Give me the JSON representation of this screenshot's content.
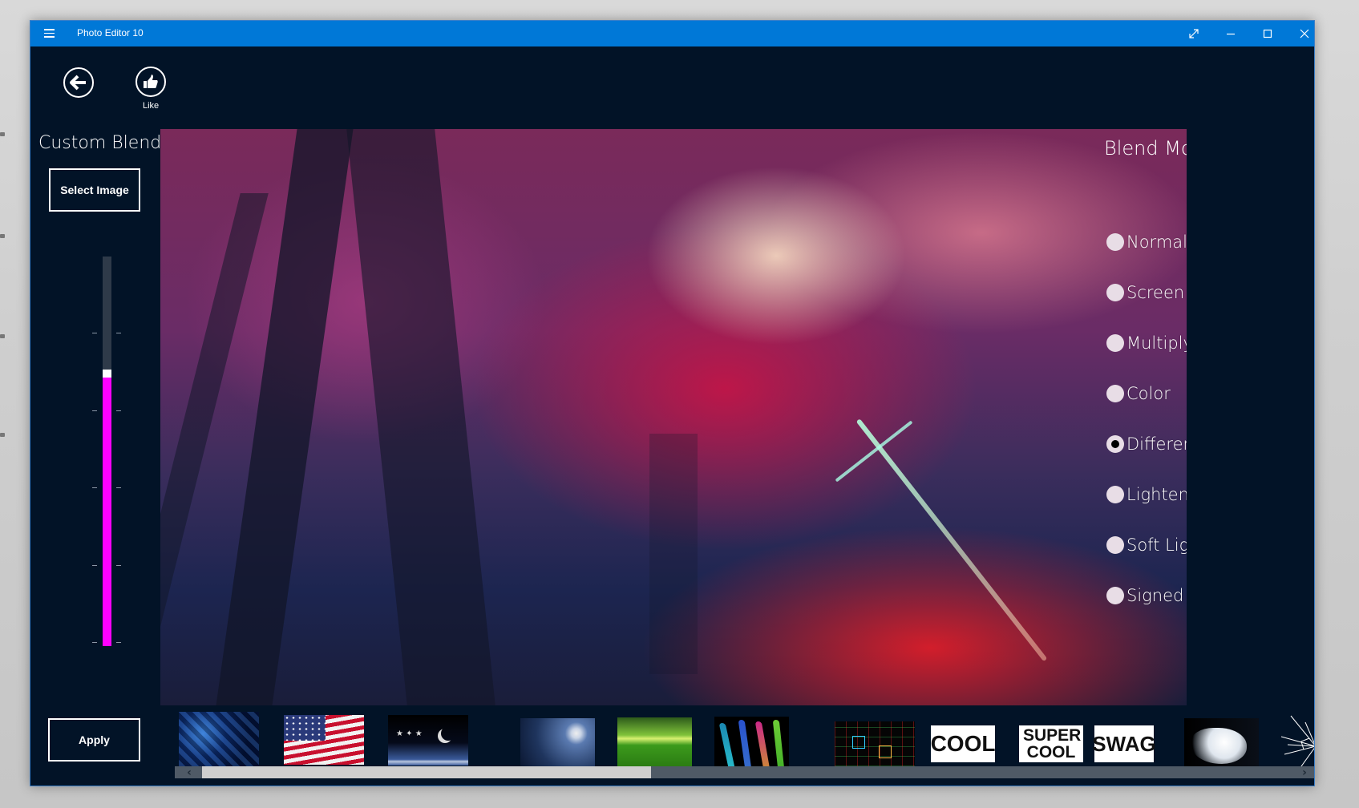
{
  "window": {
    "title": "Photo Editor 10",
    "accent_color": "#0078d7",
    "background_color": "#021327",
    "titlebar_buttons": [
      "fullscreen-icon",
      "minimize-icon",
      "maximize-icon",
      "close-icon"
    ]
  },
  "toolbar": {
    "back_icon": "arrow-left-circle-icon",
    "like_icon": "thumbs-up-icon",
    "like_label": "Like"
  },
  "left_panel": {
    "heading": "Custom Blend",
    "select_image_label": "Select Image",
    "apply_label": "Apply",
    "opacity_slider": {
      "value_percent": 69,
      "fill_color": "#ff00ff",
      "tick_count": 5
    }
  },
  "blend_mode": {
    "title": "Blend Mode",
    "options": [
      {
        "label": "Normal",
        "checked": false
      },
      {
        "label": "Screen",
        "checked": false
      },
      {
        "label": "Multiply",
        "checked": false
      },
      {
        "label": "Color",
        "checked": false
      },
      {
        "label": "Difference",
        "checked": true
      },
      {
        "label": "Lighten",
        "checked": false
      },
      {
        "label": "Soft Light",
        "checked": false
      },
      {
        "label": "Signed Di",
        "checked": false
      }
    ]
  },
  "overlay_thumbnails": [
    {
      "name": "blue-crystals"
    },
    {
      "name": "american-flag"
    },
    {
      "name": "night-stars-moon"
    },
    {
      "name": "moon-night-sky"
    },
    {
      "name": "green-forest"
    },
    {
      "name": "colored-smoke"
    },
    {
      "name": "neon-squares"
    },
    {
      "name": "cool-text",
      "text": "COOL"
    },
    {
      "name": "super-cool-text",
      "text": "SUPER COOL"
    },
    {
      "name": "swag-text",
      "text": "SWAG"
    },
    {
      "name": "white-smoke"
    },
    {
      "name": "cracked-glass"
    }
  ],
  "thumbnail_scroll": {
    "position_percent": 0,
    "visible_fraction": 0.41
  }
}
